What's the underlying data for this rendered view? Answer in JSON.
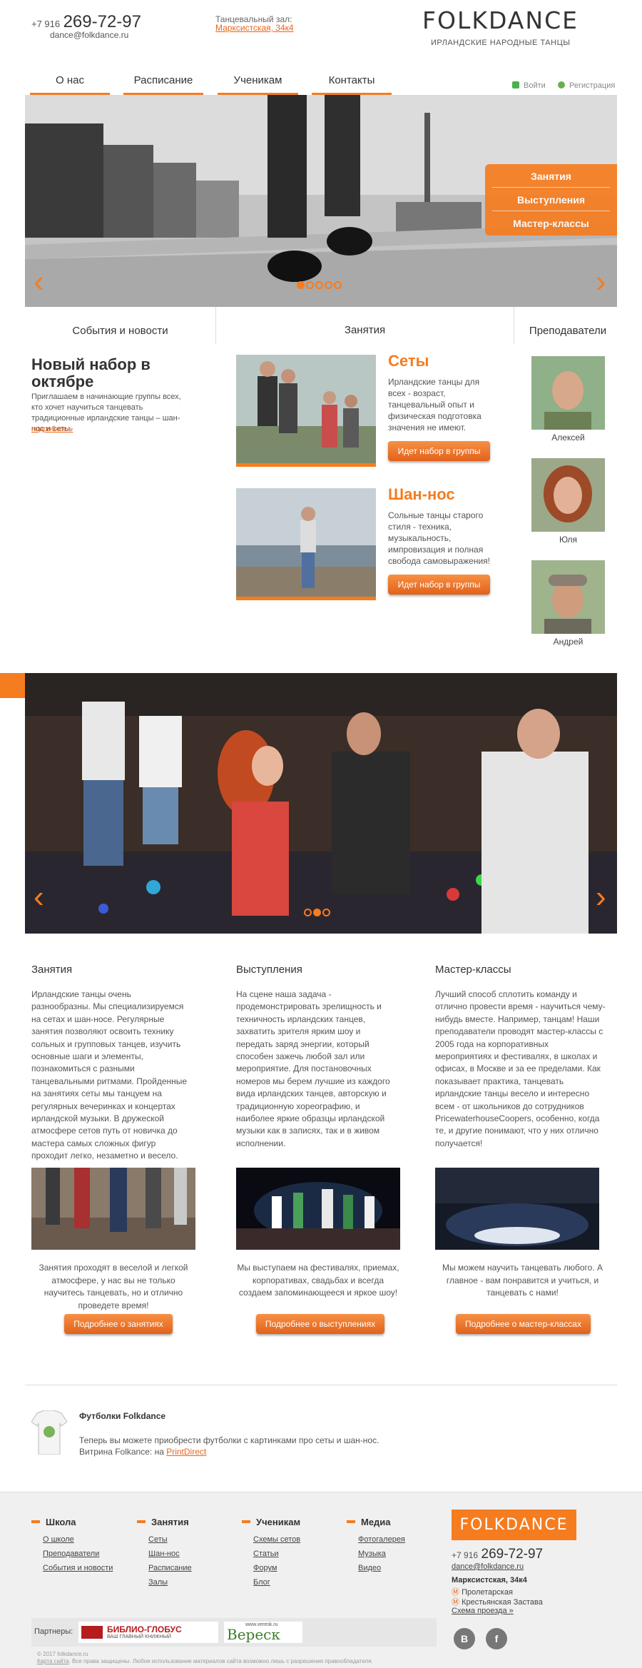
{
  "header": {
    "phone_prefix": "+7 916",
    "phone_number": "269-72-97",
    "email": "dance@folkdance.ru",
    "hall_label": "Танцевальный зал:",
    "hall_address": "Марксистская, 34к4",
    "logo": "FOLKDANCE",
    "tagline": "ИРЛАНДСКИЕ НАРОДНЫЕ ТАНЦЫ",
    "login": "Войти",
    "register": "Регистрация"
  },
  "nav": [
    {
      "label": "О нас"
    },
    {
      "label": "Расписание"
    },
    {
      "label": "Ученикам"
    },
    {
      "label": "Контакты"
    }
  ],
  "slider": {
    "menu": [
      "Занятия",
      "Выступления",
      "Мастер-классы"
    ],
    "prev_icon": "‹",
    "next_icon": "›"
  },
  "columns": {
    "news_head": "События и новости",
    "classes_head": "Занятия",
    "teachers_head": "Преподаватели"
  },
  "news": {
    "title": "Новый набор в октябре",
    "text": "Приглашаем в начинающие группы всех, кто хочет научиться танцевать традиционные ирландские танцы – шан-нос и сеты.",
    "more": "подробнее »"
  },
  "classes": [
    {
      "title": "Сеты",
      "text": "Ирландские танцы для всех - возраст, танцевальный опыт и физическая подготовка значения не имеют.",
      "button": "Идет набор в группы"
    },
    {
      "title": "Шан-нос",
      "text": "Сольные танцы старого стиля - техника, музыкальность, импровизация и полная свобода самовыражения!",
      "button": "Идет набор в группы"
    }
  ],
  "teachers": [
    {
      "name": "Алексей"
    },
    {
      "name": "Юля"
    },
    {
      "name": "Андрей"
    }
  ],
  "info": [
    {
      "head": "Занятия",
      "text": "Ирландские танцы очень разнообразны. Мы специализируемся на сетах и шан-носе. Регулярные занятия позволяют освоить технику сольных и групповых танцев, изучить основные шаги и элементы, познакомиться с разными танцевальными ритмами. Пройденные на занятиях сеты мы танцуем на регулярных вечеринках и концертах ирландской музыки. В дружеской атмосфере сетов путь от новичка до мастера самых сложных фигур проходит легко, незаметно и весело.",
      "caption": "Занятия проходят в веселой и легкой атмосфере, у нас вы не только научитесь танцевать, но и отлично проведете время!",
      "button": "Подробнее о занятиях"
    },
    {
      "head": "Выступления",
      "text": "На сцене наша задача - продемонстрировать зрелищность и техничность ирландских танцев, захватить зрителя ярким шоу и передать заряд энергии, который способен зажечь любой зал или мероприятие. Для постановочных номеров мы берем лучшие из каждого вида ирландских танцев, авторскую и традиционную хореографию, и наиболее яркие образцы ирландской музыки как в записях, так и в живом исполнении.",
      "caption": "Мы выступаем на фестивалях, приемах, корпоративах, свадьбах и всегда создаем запоминающееся и яркое шоу!",
      "button": "Подробнее о выступлениях"
    },
    {
      "head": "Мастер-классы",
      "text": "Лучший способ сплотить команду и отлично провести время - научиться чему-нибудь вместе. Например, танцам! Наши преподаватели проводят мастер-классы с 2005 года на корпоративных мероприятиях и фестивалях, в школах и офисах, в Москве и за ее пределами. Как показывает практика, танцевать ирландские танцы весело и интересно всем - от школьников до сотрудников PricewaterhouseCoopers, особенно, когда те, и другие понимают, что у них отлично получается!",
      "caption": "Мы можем научить танцевать любого. А главное - вам понравится и учиться, и танцевать с нами!",
      "button": "Подробнее о мастер-классах"
    }
  ],
  "shirts": {
    "title": "Футболки Folkdance",
    "line1": "Теперь вы можете приобрести футболки с картинками про сеты и шан-нос.",
    "line2_prefix": "Витрина Folkance: на ",
    "link": "PrintDirect"
  },
  "footer": {
    "cols": [
      {
        "head": "Школа",
        "links": [
          "О школе",
          "Преподаватели",
          "События и новости"
        ]
      },
      {
        "head": "Занятия",
        "links": [
          "Сеты",
          "Шан-нос",
          "Расписание",
          "Залы"
        ]
      },
      {
        "head": "Ученикам",
        "links": [
          "Схемы сетов",
          "Статьи",
          "Форум",
          "Блог"
        ]
      },
      {
        "head": "Медиа",
        "links": [
          "Фотогалерея",
          "Музыка",
          "Видео"
        ]
      }
    ],
    "logo": "FOLKDANCE",
    "phone_prefix": "+7 916",
    "phone_number": "269-72-97",
    "email": "dance@folkdance.ru",
    "address": "Марксистская, 34к4",
    "metro1": "Пролетарская",
    "metro2": "Крестьянская Застава",
    "map": "Схема проезда »",
    "partners_label": "Партнеры:",
    "partner1": "БИБЛИО-ГЛОБУС",
    "partner1_sub": "ВАШ ГЛАВНЫЙ КНИЖНЫЙ",
    "partner2_url": "www.veresk.ru",
    "partner2": "Вереск",
    "social": [
      "B",
      "f"
    ],
    "copyright": "© 2017 folkdance.ru",
    "copy2_link": "Карта сайта",
    "copy2": ". Все права защищены. Любое использование материалов сайта возможно лишь с разрешения правообладателя."
  }
}
